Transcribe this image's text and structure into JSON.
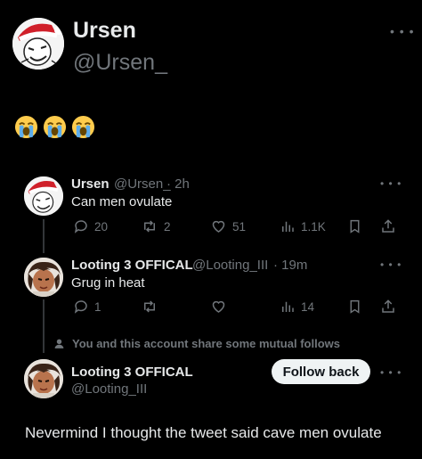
{
  "header": {
    "name": "Ursen",
    "handle": "@Ursen_"
  },
  "post": {
    "emojis": [
      "😭",
      "😭",
      "😭"
    ]
  },
  "quoted": [
    {
      "name": "Ursen",
      "handle": "@Ursen_",
      "time": "· 2h",
      "text": "Can men ovulate",
      "replies": "20",
      "reposts": "2",
      "likes": "51",
      "views": "1.1K"
    },
    {
      "name": "Looting 3 OFFICAL",
      "handle": "@Looting_III",
      "time": "· 19m",
      "text": "Grug in heat",
      "replies": "1",
      "reposts": "",
      "likes": "",
      "views": "14"
    }
  ],
  "mutual_note": "You and this account share some mutual follows",
  "reply_author": {
    "name": "Looting 3 OFFICAL",
    "handle": "@Looting_III",
    "follow_label": "Follow back"
  },
  "reply_text": "Nevermind I thought the tweet said cave men ovulate",
  "colors": {
    "background": "#000000",
    "text": "#e7e9ea",
    "muted": "#71767b",
    "button_bg": "#eff3f4"
  }
}
